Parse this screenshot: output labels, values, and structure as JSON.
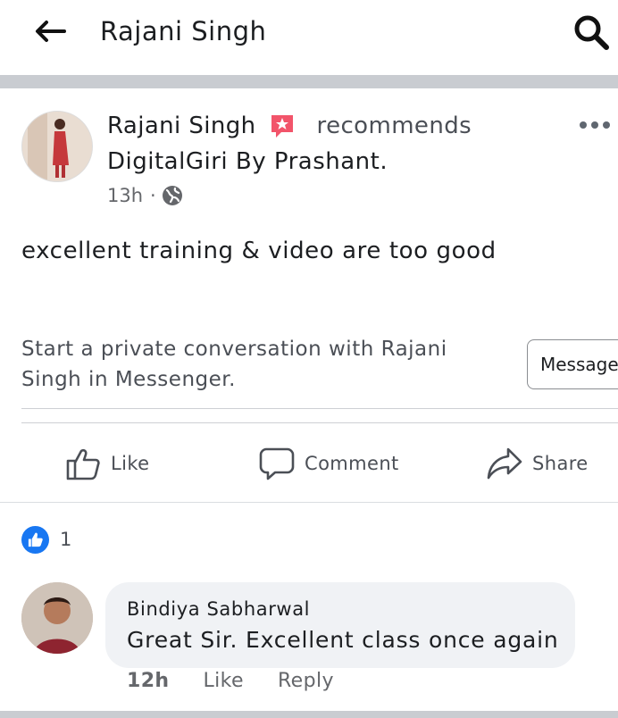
{
  "header": {
    "title": "Rajani Singh",
    "back_icon": "arrow-left-icon",
    "search_icon": "search-icon"
  },
  "post": {
    "author": "Rajani Singh",
    "badge_icon": "star-badge-icon",
    "action_word": "recommends",
    "page_name": "DigitalGiri By Prashant.",
    "time": "13h",
    "privacy_icon": "globe-icon",
    "body": "excellent training & video are too good",
    "private_prompt": "Start a private conversation with Rajani Singh in Messenger.",
    "message_button": "Message"
  },
  "actions": {
    "like": "Like",
    "comment": "Comment",
    "share": "Share"
  },
  "reactions": {
    "count": "1",
    "icon": "thumbs-up-icon"
  },
  "comment": {
    "author": "Bindiya Sabharwal",
    "text": "Great Sir. Excellent class once again",
    "time": "12h",
    "like": "Like",
    "reply": "Reply"
  },
  "colors": {
    "accent": "#1877f2",
    "badge_pink": "#f2546a",
    "secondary_text": "#65676b",
    "separator": "#c9ccd1",
    "bubble_bg": "#f0f2f5"
  }
}
